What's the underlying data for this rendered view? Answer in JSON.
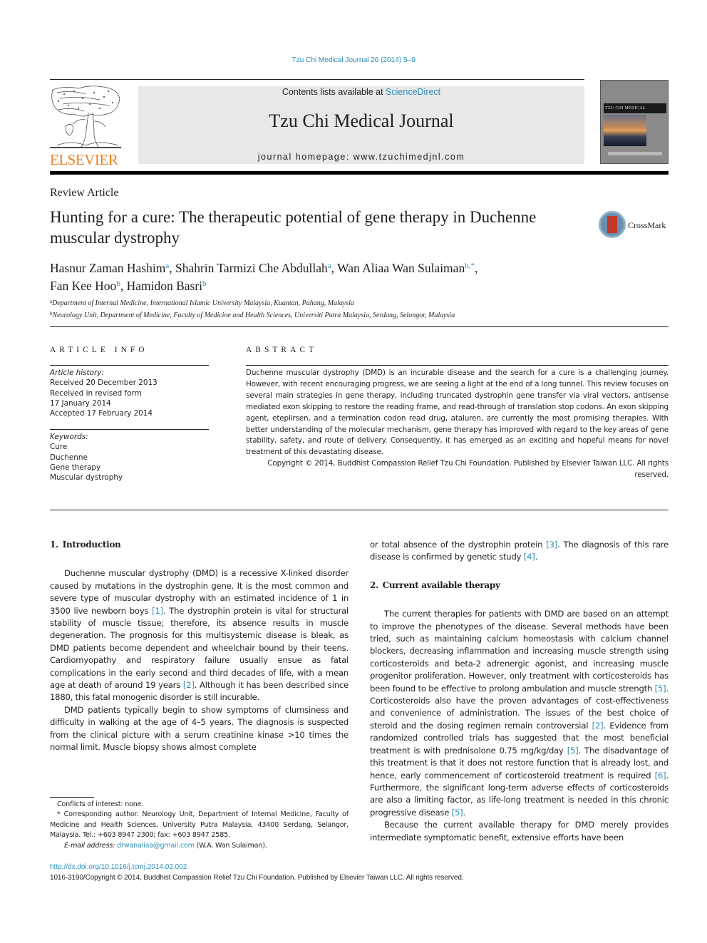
{
  "running_head": "Tzu Chi Medical Journal 26 (2014) 5–9",
  "publisher": {
    "logo_text": "ELSEVIER",
    "brand_color": "#f07e1b"
  },
  "masthead": {
    "contents_prefix": "Contents lists available at ",
    "contents_link": "ScienceDirect",
    "journal_name": "Tzu Chi Medical Journal",
    "homepage": "journal homepage: www.tzuchimedjnl.com",
    "background_color": "#e8e8e8"
  },
  "cover": {
    "title": "TZU CHI MEDICAL JOURNAL"
  },
  "link_color": "#2f8fb8",
  "article": {
    "type": "Review Article",
    "title": "Hunting for a cure: The therapeutic potential of gene therapy in Duchenne muscular dystrophy",
    "crossmark_label": "CrossMark",
    "authors": [
      {
        "name": "Hasnur Zaman Hashim",
        "sup": "a"
      },
      {
        "name": "Shahrin Tarmizi Che Abdullah",
        "sup": "a"
      },
      {
        "name": "Wan Aliaa Wan Sulaiman",
        "sup": "b,*"
      },
      {
        "name": "Fan Kee Hoo",
        "sup": "b"
      },
      {
        "name": "Hamidon Basri",
        "sup": "b"
      }
    ],
    "affiliations": [
      {
        "key": "a",
        "text": "Department of Internal Medicine, International Islamic University Malaysia, Kuantan, Pahang, Malaysia"
      },
      {
        "key": "b",
        "text": "Neurology Unit, Department of Medicine, Faculty of Medicine and Health Sciences, Universiti Putra Malaysia, Serdang, Selangor, Malaysia"
      }
    ]
  },
  "article_info": {
    "heading": "ARTICLE INFO",
    "history_label": "Article history:",
    "history": [
      "Received 20 December 2013",
      "Received in revised form",
      "17 January 2014",
      "Accepted 17 February 2014"
    ],
    "keywords_label": "Keywords:",
    "keywords": [
      "Cure",
      "Duchenne",
      "Gene therapy",
      "Muscular dystrophy"
    ]
  },
  "abstract": {
    "heading": "ABSTRACT",
    "body": "Duchenne muscular dystrophy (DMD) is an incurable disease and the search for a cure is a challenging journey. However, with recent encouraging progress, we are seeing a light at the end of a long tunnel. This review focuses on several main strategies in gene therapy, including truncated dystrophin gene transfer via viral vectors, antisense mediated exon skipping to restore the reading frame, and read-through of translation stop codons. An exon skipping agent, eteplirsen, and a termination codon read drug, ataluren, are currently the most promising therapies. With better understanding of the molecular mechanism, gene therapy has improved with regard to the key areas of gene stability, safety, and route of delivery. Consequently, it has emerged as an exciting and hopeful means for novel treatment of this devastating disease.",
    "copyright": "Copyright © 2014, Buddhist Compassion Relief Tzu Chi Foundation. Published by Elsevier Taiwan LLC. All rights reserved."
  },
  "sections": {
    "intro": {
      "heading": "1. Introduction",
      "p1": [
        {
          "t": "Duchenne muscular dystrophy (DMD) is a recessive X-linked disorder caused by mutations in the dystrophin gene. It is the most common and severe type of muscular dystrophy with an estimated incidence of 1 in 3500 live newborn boys "
        },
        {
          "ref": "[1]"
        },
        {
          "t": ". The dystrophin protein is vital for structural stability of muscle tissue; therefore, its absence results in muscle degeneration. The prognosis for this multisystemic disease is bleak, as DMD patients become dependent and wheelchair bound by their teens. Cardiomyopathy and respiratory failure usually ensue as fatal complications in the early second and third decades of life, with a mean age at death of around 19 years "
        },
        {
          "ref": "[2]"
        },
        {
          "t": ". Although it has been described since 1880, this fatal monogenic disorder is still incurable."
        }
      ],
      "p2": [
        {
          "t": "DMD patients typically begin to show symptoms of clumsiness and difficulty in walking at the age of 4–5 years. The diagnosis is suspected from the clinical picture with a serum creatinine kinase >10 times the normal limit. Muscle biopsy shows almost complete"
        }
      ],
      "p2_cont": [
        {
          "t": "or total absence of the dystrophin protein "
        },
        {
          "ref": "[3]"
        },
        {
          "t": ". The diagnosis of this rare disease is confirmed by genetic study "
        },
        {
          "ref": "[4]"
        },
        {
          "t": "."
        }
      ]
    },
    "therapy": {
      "heading": "2. Current available therapy",
      "p1": [
        {
          "t": "The current therapies for patients with DMD are based on an attempt to improve the phenotypes of the disease. Several methods have been tried, such as maintaining calcium homeostasis with calcium channel blockers, decreasing inflammation and increasing muscle strength using corticosteroids and beta-2 adrenergic agonist, and increasing muscle progenitor proliferation. However, only treatment with corticosteroids has been found to be effective to prolong ambulation and muscle strength "
        },
        {
          "ref": "[5]"
        },
        {
          "t": ". Corticosteroids also have the proven advantages of cost-effectiveness and convenience of administration. The issues of the best choice of steroid and the dosing regimen remain controversial "
        },
        {
          "ref": "[2]"
        },
        {
          "t": ". Evidence from randomized controlled trials has suggested that the most beneficial treatment is with prednisolone 0.75 mg/kg/day "
        },
        {
          "ref": "[5]"
        },
        {
          "t": ". The disadvantage of this treatment is that it does not restore function that is already lost, and hence, early commencement of corticosteroid treatment is required "
        },
        {
          "ref": "[6]"
        },
        {
          "t": ". Furthermore, the significant long-term adverse effects of corticosteroids are also a limiting factor, as life-long treatment is needed in this chronic progressive disease "
        },
        {
          "ref": "[5]"
        },
        {
          "t": "."
        }
      ],
      "p2": [
        {
          "t": "Because the current available therapy for DMD merely provides intermediate symptomatic benefit, extensive efforts have been"
        }
      ]
    }
  },
  "footnotes": {
    "conflicts": "Conflicts of interest: none.",
    "corresponding": "* Corresponding author. Neurology Unit, Department of Internal Medicine, Faculty of Medicine and Health Sciences, University Putra Malaysia, 43400 Serdang, Selangor, Malaysia. Tel.: +603 8947 2300; fax: +603 8947 2585.",
    "email_label": "E-mail address:",
    "email": "drwanaliaa@gmail.com",
    "email_suffix": " (W.A. Wan Sulaiman)."
  },
  "doi": "http://dx.doi.org/10.1016/j.tcmj.2014.02.002",
  "issn_copyright": "1016-3190/Copyright © 2014, Buddhist Compassion Relief Tzu Chi Foundation. Published by Elsevier Taiwan LLC. All rights reserved."
}
